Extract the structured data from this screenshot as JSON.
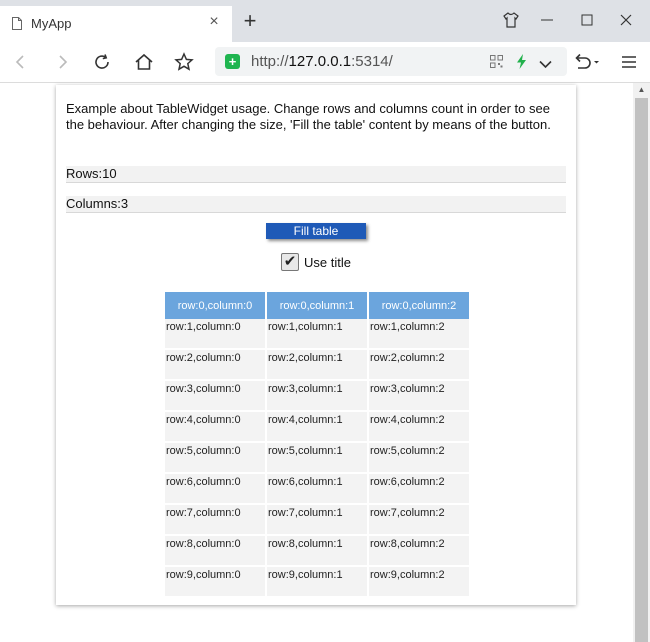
{
  "browser": {
    "tab_title": "MyApp",
    "tab_close": "×",
    "new_tab": "+",
    "url_prefix": "http://",
    "url_host": "127.0.0.1",
    "url_port": ":5314/"
  },
  "page": {
    "description": "Example about TableWidget usage. Change rows and columns count in order to see the behaviour. After changing the size, 'Fill the table' content by means of the button.",
    "rows_label": "Rows:",
    "rows_value": "10",
    "columns_label": "Columns:",
    "columns_value": "3",
    "fill_button": "Fill table",
    "use_title_label": "Use title",
    "use_title_checked": true
  },
  "table": {
    "headers": [
      "row:0,column:0",
      "row:0,column:1",
      "row:0,column:2"
    ],
    "rows": [
      [
        "row:1,column:0",
        "row:1,column:1",
        "row:1,column:2"
      ],
      [
        "row:2,column:0",
        "row:2,column:1",
        "row:2,column:2"
      ],
      [
        "row:3,column:0",
        "row:3,column:1",
        "row:3,column:2"
      ],
      [
        "row:4,column:0",
        "row:4,column:1",
        "row:4,column:2"
      ],
      [
        "row:5,column:0",
        "row:5,column:1",
        "row:5,column:2"
      ],
      [
        "row:6,column:0",
        "row:6,column:1",
        "row:6,column:2"
      ],
      [
        "row:7,column:0",
        "row:7,column:1",
        "row:7,column:2"
      ],
      [
        "row:8,column:0",
        "row:8,column:1",
        "row:8,column:2"
      ],
      [
        "row:9,column:0",
        "row:9,column:1",
        "row:9,column:2"
      ]
    ]
  },
  "colors": {
    "header_bg": "#6ba5dd",
    "button_bg": "#1f5ab7",
    "cell_bg": "#f3f3f3"
  },
  "icons": [
    "document-icon",
    "shirt-icon",
    "minimize-icon",
    "maximize-icon",
    "close-icon",
    "back-icon",
    "forward-icon",
    "reload-icon",
    "home-icon",
    "star-icon",
    "shield-icon",
    "qr-icon",
    "lightning-icon",
    "chevron-down-icon",
    "undo-icon",
    "menu-icon",
    "checkmark-icon"
  ]
}
